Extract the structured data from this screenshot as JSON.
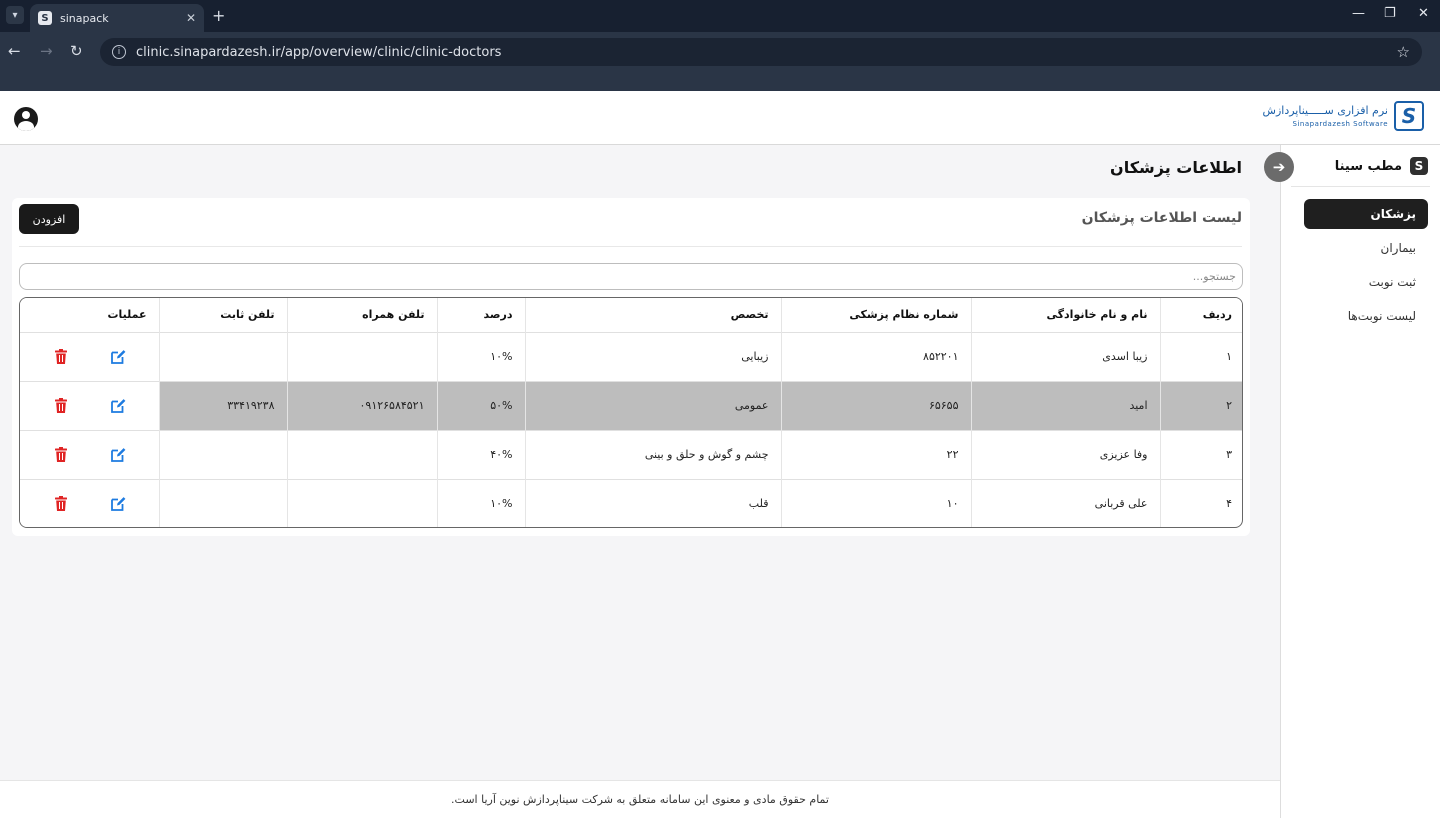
{
  "browser": {
    "tab_title": "sinapack",
    "url": "clinic.sinapardazesh.ir/app/overview/clinic/clinic-doctors"
  },
  "header": {
    "logo_fa": "نرم افزاری ســـــیناپردازش",
    "logo_en": "Sinapardazesh Software",
    "logo_mark": "S"
  },
  "sidebar": {
    "brand_name": "مطب سینا",
    "brand_mark": "S",
    "items": [
      {
        "label": "پزشکان",
        "active": true
      },
      {
        "label": "بیماران",
        "active": false
      },
      {
        "label": "ثبت نوبت",
        "active": false
      },
      {
        "label": "لیست نوبت‌ها",
        "active": false
      }
    ]
  },
  "page": {
    "title": "اطلاعات پزشکان",
    "card_title": "لیست اطلاعات پزشکان",
    "add_label": "افزودن",
    "search_placeholder": "جستجو..."
  },
  "table": {
    "headers": {
      "index": "ردیف",
      "name": "نام و نام خانوادگی",
      "medical_id": "شماره نظام پزشکی",
      "specialty": "تخصص",
      "percent": "درصد",
      "mobile": "تلفن همراه",
      "phone": "تلفن ثابت",
      "ops": "عملیات"
    },
    "rows": [
      {
        "index": "۱",
        "name": "زیبا اسدی",
        "medical_id": "۸۵۲۲۰۱",
        "specialty": "زیبایی",
        "percent": "۱۰%",
        "mobile": "",
        "phone": ""
      },
      {
        "index": "۲",
        "name": "امید",
        "medical_id": "۶۵۶۵۵",
        "specialty": "عمومی",
        "percent": "۵۰%",
        "mobile": "۰۹۱۲۶۵۸۴۵۲۱",
        "phone": "۳۳۴۱۹۲۳۸"
      },
      {
        "index": "۳",
        "name": "وفا عزیزی",
        "medical_id": "۲۲",
        "specialty": "چشم و گوش و حلق و بینی",
        "percent": "۴۰%",
        "mobile": "",
        "phone": ""
      },
      {
        "index": "۴",
        "name": "علی قربانی",
        "medical_id": "۱۰",
        "specialty": "قلب",
        "percent": "۱۰%",
        "mobile": "",
        "phone": ""
      }
    ]
  },
  "footer": {
    "text": "تمام حقوق مادی و معنوی این سامانه متعلق به شرکت سیناپردازش نوین آریا است."
  },
  "colors": {
    "accent_dark": "#1a1a1a",
    "edit_icon": "#1d7be0",
    "delete_icon": "#e02424",
    "row_highlight": "#bdbdbd",
    "logo_blue": "#1a5fa8"
  }
}
